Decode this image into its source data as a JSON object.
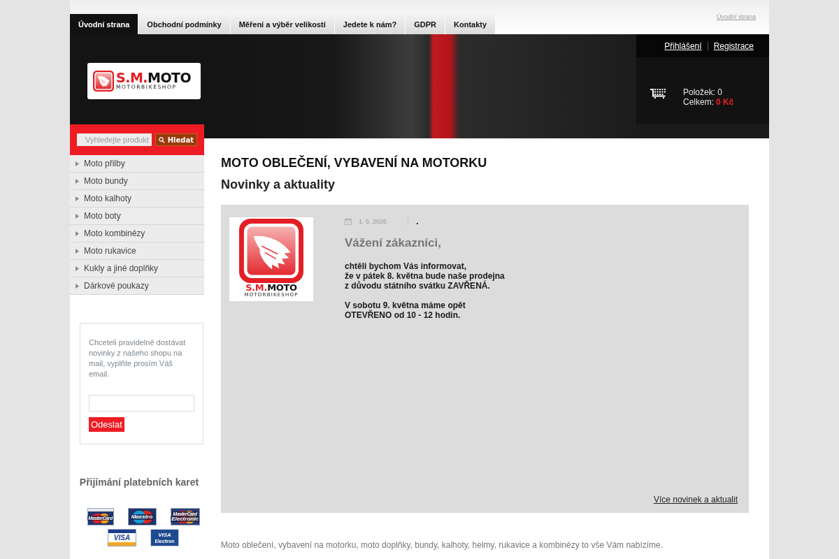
{
  "nav": {
    "tabs": [
      {
        "label": "Úvodní strana",
        "selected": true
      },
      {
        "label": "Obchodní podmínky",
        "selected": false
      },
      {
        "label": "Měření a výběr velikostí",
        "selected": false
      },
      {
        "label": "Jedete k nám?",
        "selected": false
      },
      {
        "label": "GDPR",
        "selected": false
      },
      {
        "label": "Kontakty",
        "selected": false
      }
    ]
  },
  "breadcrumb": {
    "label": "Úvodní strana"
  },
  "logo": {
    "parts": [
      "S.M.",
      "MOTO"
    ],
    "tagline": "MOTORBIKESHOP"
  },
  "account_links": [
    {
      "label": "Přihlášení"
    },
    {
      "label": "Registrace"
    }
  ],
  "cart": {
    "items": "Položek: 0",
    "total_label": "Celkem:",
    "total": "0 Kč"
  },
  "search": {
    "placeholder": "Vyhledejte produkt",
    "button": "Hledat"
  },
  "categories": [
    {
      "label": "Moto přilby"
    },
    {
      "label": "Moto bundy"
    },
    {
      "label": "Moto kalhoty"
    },
    {
      "label": "Moto boty"
    },
    {
      "label": "Moto kombinézy"
    },
    {
      "label": "Moto rukavice"
    },
    {
      "label": "Kukly a jiné doplňky"
    },
    {
      "label": "Dárkové poukazy"
    }
  ],
  "newsletter": {
    "text": "Chceteli pravidelně dostávat novinky z našeho shopu na mail, vyplňte prosím Váš email.",
    "button": "Odeslat"
  },
  "payment": {
    "title": "Přijímání platebních karet",
    "cards": [
      {
        "kind": "eurocard",
        "lines": [
          "MasterCard"
        ]
      },
      {
        "kind": "maestro",
        "lines": [
          "Maestro"
        ]
      },
      {
        "kind": "electronic",
        "lines": [
          "MasterCard",
          "Electronic"
        ]
      },
      {
        "kind": "visa",
        "lines": [
          "VISA"
        ]
      },
      {
        "kind": "visa-electron",
        "lines": [
          "VISA",
          "Electron"
        ]
      }
    ]
  },
  "content": {
    "title": "MOTO OBLEČENÍ, VYBAVENÍ NA MOTORKU",
    "subtitle": "Novinky a aktuality"
  },
  "news": {
    "image": {
      "parts": [
        "S.M.",
        "MOTO"
      ],
      "tagline": "MOTORBIKESHOP"
    },
    "date": "1. 5. 2026",
    "author": ".",
    "heading": "Vážení zákazníci,",
    "paragraphs": [
      "chtěli bychom Vás informovat,\nže v pátek 8. května bude naše prodejna\nz důvodu státního svátku ZAVŘENÁ.",
      "V sobotu 9. května máme opět\nOTEVŘENO od 10 - 12 hodin."
    ],
    "more_link": "Více novinek a aktualit"
  },
  "footer_text": "Moto oblečení, vybavení na motorku, moto doplňky, bundy, kalhoty, helmy, rukavice a kombinézy to vše Vám nabízíme."
}
